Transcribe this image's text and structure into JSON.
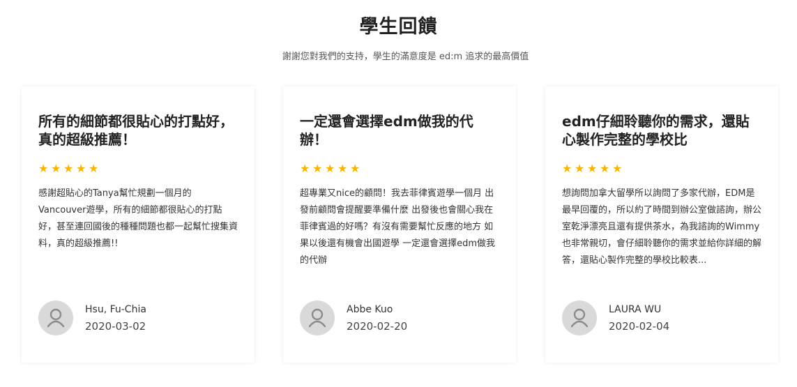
{
  "section": {
    "title": "學生回饋",
    "subtitle": "謝謝您對我們的支持，學生的滿意度是 ed:m 追求的最高價值"
  },
  "cards": [
    {
      "title": "所有的細節都很貼心的打點好，真的超級推薦！",
      "rating": 5,
      "body": "感謝超貼心的Tanya幫忙規劃一個月的Vancouver遊學，所有的細節都很貼心的打點好，甚至連回國後的種種問題也都一起幫忙搜集資料，真的超級推薦!!",
      "name": "Hsu, Fu-Chia",
      "date": "2020-03-02"
    },
    {
      "title": "一定還會選擇edm做我的代辦！",
      "rating": 5,
      "body": "超專業又nice的顧問！我去菲律賓遊學一個月 出發前顧問會提醒要準備什麼 出發後也會關心我在菲律賓過的好嗎？有沒有需要幫忙反應的地方 如果以後還有機會出國遊學 一定還會選擇edm做我的代辦",
      "name": "Abbe Kuo",
      "date": "2020-02-20"
    },
    {
      "title": "edm仔細聆聽你的需求，還貼心製作完整的學校比",
      "rating": 5,
      "body": "想詢問加拿大留學所以詢問了多家代辦，EDM是最早回覆的，所以約了時間到辦公室做諮詢，辦公室乾淨漂亮且還有提供茶水，為我諮詢的Wimmy也非常親切，會仔細聆聽你的需求並給你詳細的解答，還貼心製作完整的學校比較表...",
      "name": "LAURA WU",
      "date": "2020-02-04"
    }
  ],
  "icons": {
    "star": "star-icon",
    "avatar": "user-avatar-icon"
  },
  "colors": {
    "star": "#f6b500",
    "avatar_bg": "#d9d9d9"
  }
}
